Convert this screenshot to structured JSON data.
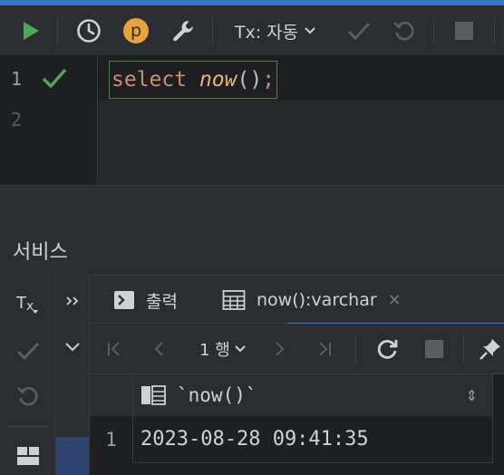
{
  "toolbar": {
    "tx_mode": "Tx: 자동",
    "icons": [
      "play-icon",
      "history-icon",
      "profile-p-icon",
      "wrench-icon",
      "tx-mode-chevron-icon",
      "commit-check-icon",
      "rollback-icon",
      "stop-icon"
    ],
    "p_badge": "p",
    "colors": {
      "run": "#4fa854",
      "badge": "#e8a33d"
    }
  },
  "editor": {
    "lines": [
      "1",
      "2"
    ],
    "code": {
      "keyword": "select",
      "space": " ",
      "function": "now",
      "parens": "()",
      "semicolon": ";"
    },
    "status_icon": "success-check-icon"
  },
  "services": {
    "title": "서비스",
    "left_icons": [
      "tx-icon",
      "commit-check-icon",
      "rollback-icon",
      "layout-icon"
    ],
    "mid_icons": [
      "expand-chevrons-icon",
      "chevron-down-icon"
    ],
    "tabs": [
      {
        "label": "출력",
        "icon": "console-output-icon"
      },
      {
        "label": "now():varchar",
        "icon": "table-icon",
        "close": "✕"
      }
    ],
    "results_toolbar": {
      "page": "1 행",
      "icons": [
        "first-page-icon",
        "prev-page-icon",
        "next-page-icon",
        "last-page-icon",
        "refresh-icon",
        "stop-icon",
        "pin-icon"
      ]
    },
    "grid": {
      "columns": [
        {
          "name": "`now()`",
          "sort": "⇕"
        }
      ],
      "rows": [
        {
          "num": "1",
          "values": [
            "2023-08-28 09:41:35"
          ]
        }
      ]
    }
  }
}
